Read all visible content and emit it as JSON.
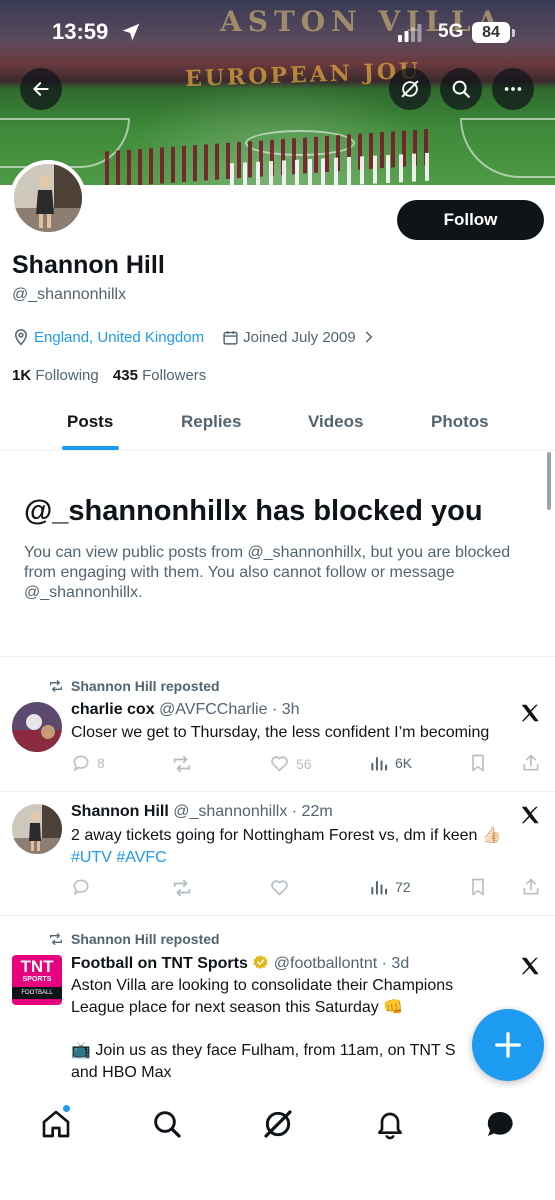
{
  "status_bar": {
    "time": "13:59",
    "network": "5G",
    "battery": "84"
  },
  "banner": {
    "text_top": "ASTON VILLA",
    "text_mid": "EUROPEAN JOU"
  },
  "profile": {
    "name": "Shannon Hill",
    "handle": "@_shannonhillx",
    "location": "England, United Kingdom",
    "joined": "Joined July 2009",
    "following_count": "1K",
    "following_label": "Following",
    "followers_count": "435",
    "followers_label": "Followers",
    "follow_button": "Follow"
  },
  "tabs": [
    {
      "label": "Posts",
      "active": true
    },
    {
      "label": "Replies",
      "active": false
    },
    {
      "label": "Videos",
      "active": false
    },
    {
      "label": "Photos",
      "active": false
    }
  ],
  "blocked": {
    "title": "@_shannonhillx has blocked you",
    "body": "You can view public posts from @_shannonhillx, but you are blocked from engaging with them. You also cannot follow or message @_shannonhillx."
  },
  "posts": [
    {
      "repost_label": "Shannon Hill reposted",
      "name": "charlie cox",
      "handle": "@AVFCCharlie",
      "time": "· 3h",
      "text": "Closer we get to Thursday, the less confident I’m becoming",
      "replies": "8",
      "likes": "56",
      "views": "6K"
    },
    {
      "name": "Shannon Hill",
      "handle": "@_shannonhillx",
      "time": "· 22m",
      "text": "2 away tickets going for Nottingham Forest vs, dm if keen 👍🏻",
      "hashtags": "#UTV #AVFC",
      "views": "72"
    },
    {
      "repost_label": "Shannon Hill reposted",
      "name": "Football on TNT Sports",
      "handle": "@footballontnt",
      "time": "· 3d",
      "text_line1": "Aston Villa are looking to consolidate their Champions",
      "text_line2": "League place for next season this Saturday 👊",
      "text_line3": "📺 Join us as they face Fulham, from 11am, on TNT S",
      "text_line4": "and HBO Max",
      "avatar_text_top": "TNT",
      "avatar_text_mid": "SPORTS",
      "avatar_text_bot": "FOOTBALL"
    }
  ],
  "colors": {
    "accent": "#1d9bf0",
    "text": "#0f1419",
    "muted": "#536471"
  }
}
